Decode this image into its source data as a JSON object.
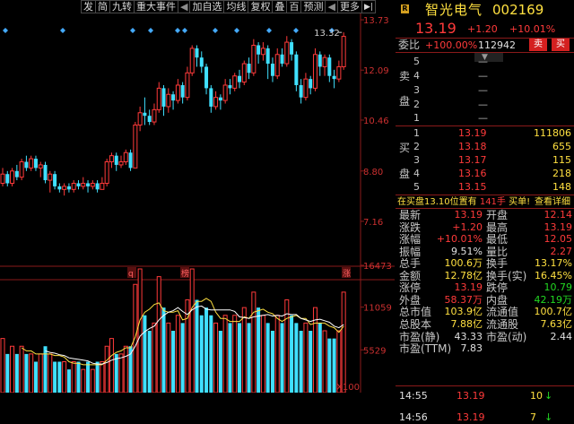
{
  "toolbar": {
    "buttons": [
      "发",
      "简",
      "九转",
      "重大事件",
      "◀",
      "加自选",
      "均线",
      "复权",
      "叠",
      "百",
      "预测",
      "◀",
      "更多"
    ],
    "arrow": "▶|"
  },
  "chart": {
    "price_ticks": [
      "13.73",
      "12.09",
      "10.46",
      "8.80",
      "7.16"
    ],
    "volume_ticks": [
      "16473",
      "11059",
      "5529",
      "X100"
    ],
    "last_price_label": "13.32",
    "markers": [
      "q",
      "榜",
      "涨"
    ]
  },
  "chart_data": {
    "type": "candlestick",
    "ylim": [
      5.9,
      13.85
    ],
    "candles": [
      [
        8.4,
        8.7,
        8.9,
        8.3
      ],
      [
        8.7,
        8.4,
        8.8,
        8.3
      ],
      [
        8.4,
        8.8,
        8.9,
        8.3
      ],
      [
        8.8,
        8.6,
        9.0,
        8.5
      ],
      [
        8.6,
        9.1,
        9.2,
        8.5
      ],
      [
        9.1,
        8.9,
        9.3,
        8.8
      ],
      [
        8.9,
        9.2,
        9.3,
        8.8
      ],
      [
        9.2,
        8.9,
        9.3,
        8.8
      ],
      [
        8.9,
        9.0,
        9.1,
        8.6
      ],
      [
        9.0,
        8.5,
        9.1,
        8.4
      ],
      [
        8.5,
        8.7,
        8.8,
        8.1
      ],
      [
        8.7,
        8.3,
        8.8,
        8.2
      ],
      [
        8.3,
        8.2,
        8.4,
        8.1
      ],
      [
        8.2,
        8.3,
        8.4,
        8.0
      ],
      [
        8.3,
        8.2,
        8.4,
        8.1
      ],
      [
        8.2,
        8.4,
        8.5,
        8.1
      ],
      [
        8.4,
        8.3,
        8.5,
        8.2
      ],
      [
        8.3,
        8.4,
        8.6,
        8.2
      ],
      [
        8.4,
        8.3,
        8.5,
        8.1
      ],
      [
        8.3,
        8.4,
        8.5,
        8.2
      ],
      [
        8.4,
        8.2,
        8.5,
        8.1
      ],
      [
        8.2,
        8.4,
        8.6,
        8.2
      ],
      [
        8.4,
        9.1,
        9.2,
        8.3
      ],
      [
        9.1,
        9.3,
        9.4,
        8.9
      ],
      [
        9.3,
        9.0,
        9.4,
        8.8
      ],
      [
        9.0,
        9.1,
        9.3,
        8.9
      ],
      [
        9.1,
        9.4,
        9.5,
        9.0
      ],
      [
        9.4,
        8.9,
        9.5,
        8.8
      ],
      [
        8.9,
        10.3,
        10.4,
        8.9
      ],
      [
        10.3,
        10.7,
        10.9,
        10.1
      ],
      [
        10.7,
        10.6,
        11.2,
        10.3
      ],
      [
        10.6,
        10.4,
        10.8,
        10.3
      ],
      [
        10.4,
        10.8,
        11.0,
        10.3
      ],
      [
        10.8,
        11.5,
        11.7,
        10.7
      ],
      [
        11.5,
        10.9,
        11.6,
        10.6
      ],
      [
        10.9,
        11.3,
        11.5,
        10.7
      ],
      [
        11.3,
        11.1,
        11.4,
        10.8
      ],
      [
        11.1,
        11.6,
        11.8,
        11.0
      ],
      [
        11.6,
        11.2,
        11.7,
        11.0
      ],
      [
        11.2,
        12.0,
        12.2,
        11.1
      ],
      [
        12.0,
        12.8,
        12.9,
        11.9
      ],
      [
        12.8,
        12.5,
        12.9,
        12.2
      ],
      [
        12.5,
        12.2,
        12.7,
        12.0
      ],
      [
        12.2,
        11.5,
        12.3,
        11.3
      ],
      [
        11.5,
        10.9,
        11.6,
        10.7
      ],
      [
        10.9,
        11.2,
        11.4,
        10.8
      ],
      [
        11.2,
        11.1,
        11.3,
        10.8
      ],
      [
        11.1,
        11.6,
        11.8,
        11.0
      ],
      [
        11.6,
        11.5,
        11.8,
        11.3
      ],
      [
        11.5,
        11.9,
        12.0,
        11.4
      ],
      [
        11.9,
        11.7,
        12.1,
        11.5
      ],
      [
        11.7,
        12.3,
        12.4,
        11.6
      ],
      [
        12.3,
        12.0,
        12.5,
        11.8
      ],
      [
        12.0,
        12.9,
        13.1,
        11.9
      ],
      [
        12.9,
        12.6,
        13.0,
        12.3
      ],
      [
        12.6,
        12.8,
        13.0,
        12.4
      ],
      [
        12.8,
        12.3,
        12.9,
        11.8
      ],
      [
        12.3,
        11.9,
        12.5,
        11.7
      ],
      [
        11.9,
        12.6,
        12.8,
        11.8
      ],
      [
        12.6,
        12.3,
        12.8,
        12.2
      ],
      [
        12.3,
        13.0,
        13.2,
        12.2
      ],
      [
        13.0,
        12.6,
        13.1,
        12.4
      ],
      [
        12.6,
        11.6,
        12.7,
        11.4
      ],
      [
        11.6,
        11.2,
        11.8,
        11.0
      ],
      [
        11.2,
        11.8,
        12.0,
        11.1
      ],
      [
        11.8,
        11.5,
        11.9,
        11.3
      ],
      [
        11.5,
        12.6,
        12.8,
        11.4
      ],
      [
        12.6,
        12.2,
        12.7,
        11.9
      ],
      [
        12.2,
        12.5,
        12.6,
        11.9
      ],
      [
        12.5,
        11.9,
        12.6,
        11.7
      ],
      [
        11.9,
        11.8,
        12.1,
        11.5
      ],
      [
        11.8,
        12.2,
        12.4,
        11.7
      ],
      [
        12.2,
        13.19,
        13.32,
        12.1
      ]
    ],
    "volumes": [
      7,
      5,
      6,
      5,
      6,
      5,
      5,
      4,
      5,
      6,
      5,
      4,
      4,
      4,
      3,
      4,
      4,
      3,
      4,
      3,
      4,
      4,
      6,
      7,
      5,
      5,
      6,
      6,
      14,
      16,
      10,
      8,
      9,
      15,
      11,
      9,
      8,
      10,
      9,
      12,
      16,
      12,
      10,
      11,
      10,
      9,
      8,
      10,
      9,
      10,
      9,
      11,
      9,
      13,
      11,
      10,
      9,
      8,
      10,
      9,
      12,
      10,
      9,
      8,
      9,
      8,
      11,
      9,
      8,
      7,
      7,
      8,
      13
    ],
    "volume_max": 16473
  },
  "stock": {
    "badge": "R",
    "name": "智光电气",
    "code": "002169",
    "price": "13.19",
    "change": "+1.20",
    "change_pct": "+10.01%"
  },
  "weibi": {
    "label": "委比",
    "pct": "+100.00%",
    "value": "112942",
    "sell_btn": "卖",
    "buy_btn": "买"
  },
  "sell_side": {
    "chars": [
      "卖",
      "盘"
    ],
    "rows": [
      {
        "n": "5",
        "p": "—",
        "v": ""
      },
      {
        "n": "4",
        "p": "—",
        "v": ""
      },
      {
        "n": "3",
        "p": "—",
        "v": ""
      },
      {
        "n": "2",
        "p": "—",
        "v": ""
      },
      {
        "n": "1",
        "p": "—",
        "v": ""
      }
    ]
  },
  "buy_side": {
    "chars": [
      "买",
      "盘"
    ],
    "rows": [
      {
        "n": "1",
        "p": "13.19",
        "v": "111806"
      },
      {
        "n": "2",
        "p": "13.18",
        "v": "655"
      },
      {
        "n": "3",
        "p": "13.17",
        "v": "115"
      },
      {
        "n": "4",
        "p": "13.16",
        "v": "218"
      },
      {
        "n": "5",
        "p": "13.15",
        "v": "148"
      }
    ]
  },
  "notice": {
    "text_a": "在买盘13.10位置有",
    "qty": "141手",
    "text_b": "买单!",
    "link": "查看详细"
  },
  "quote": [
    {
      "l": "最新",
      "v": "13.19",
      "vc": "red",
      "l2": "开盘",
      "v2": "12.14",
      "v2c": "red"
    },
    {
      "l": "涨跌",
      "v": "+1.20",
      "vc": "red",
      "l2": "最高",
      "v2": "13.19",
      "v2c": "red"
    },
    {
      "l": "涨幅",
      "v": "+10.01%",
      "vc": "red",
      "l2": "最低",
      "v2": "12.05",
      "v2c": "red"
    },
    {
      "l": "振幅",
      "v": "9.51%",
      "vc": "white",
      "l2": "量比",
      "v2": "2.27",
      "v2c": "red"
    },
    {
      "l": "总手",
      "v": "100.6万",
      "vc": "yellow",
      "l2": "换手",
      "v2": "13.17%",
      "v2c": "yellow"
    },
    {
      "l": "金额",
      "v": "12.78亿",
      "vc": "yellow",
      "l2": "换手(实)",
      "v2": "16.45%",
      "v2c": "yellow"
    },
    {
      "l": "涨停",
      "v": "13.19",
      "vc": "red",
      "l2": "跌停",
      "v2": "10.79",
      "v2c": "green"
    },
    {
      "l": "外盘",
      "v": "58.37万",
      "vc": "red",
      "l2": "内盘",
      "v2": "42.19万",
      "v2c": "green"
    },
    {
      "l": "总市值",
      "v": "103.9亿",
      "vc": "yellow",
      "l2": "流通值",
      "v2": "100.7亿",
      "v2c": "yellow"
    },
    {
      "l": "总股本",
      "v": "7.88亿",
      "vc": "yellow",
      "l2": "流通股",
      "v2": "7.63亿",
      "v2c": "yellow"
    },
    {
      "l": "市盈(静)",
      "v": "43.33",
      "vc": "white",
      "l2": "市盈(动)",
      "v2": "2.44",
      "v2c": "white"
    },
    {
      "l": "市盈(TTM)",
      "v": "7.83",
      "vc": "white",
      "l2": "",
      "v2": "",
      "v2c": "white"
    }
  ],
  "ticks": [
    {
      "t": "14:55",
      "p": "13.19",
      "v": "10",
      "arrow": "↓"
    },
    {
      "t": "14:56",
      "p": "13.19",
      "v": "7",
      "arrow": "↓"
    }
  ],
  "colors": {
    "up": "#ff3a3a",
    "down": "#40e0ff",
    "grid": "#8a1a1a",
    "ma1": "#ffffff",
    "ma2": "#ffe040",
    "marker": "#44aaff"
  }
}
